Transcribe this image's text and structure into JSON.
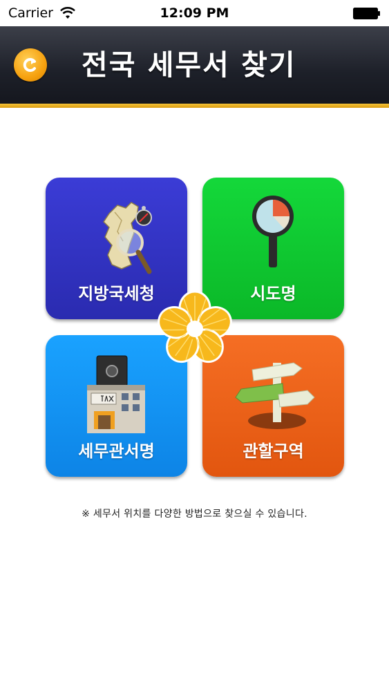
{
  "status_bar": {
    "carrier": "Carrier",
    "time": "12:09 PM"
  },
  "header": {
    "title": "전국 세무서 찾기",
    "back_icon": "back-arrow-icon",
    "accent_color": "#f5b21e"
  },
  "tiles": [
    {
      "label": "지방국세청",
      "icon": "korea-map-magnifier-icon",
      "color": "#3333cc"
    },
    {
      "label": "시도명",
      "icon": "magnifier-pie-icon",
      "color": "#11cc33"
    },
    {
      "label": "세무관서명",
      "icon": "tax-office-building-icon",
      "color": "#1199f5"
    },
    {
      "label": "관할구역",
      "icon": "signpost-icon",
      "color": "#ee6622"
    }
  ],
  "center_emblem": "flower-emblem-icon",
  "footer_note": "※ 세무서 위치를 다양한 방법으로 찾으실 수 있습니다."
}
